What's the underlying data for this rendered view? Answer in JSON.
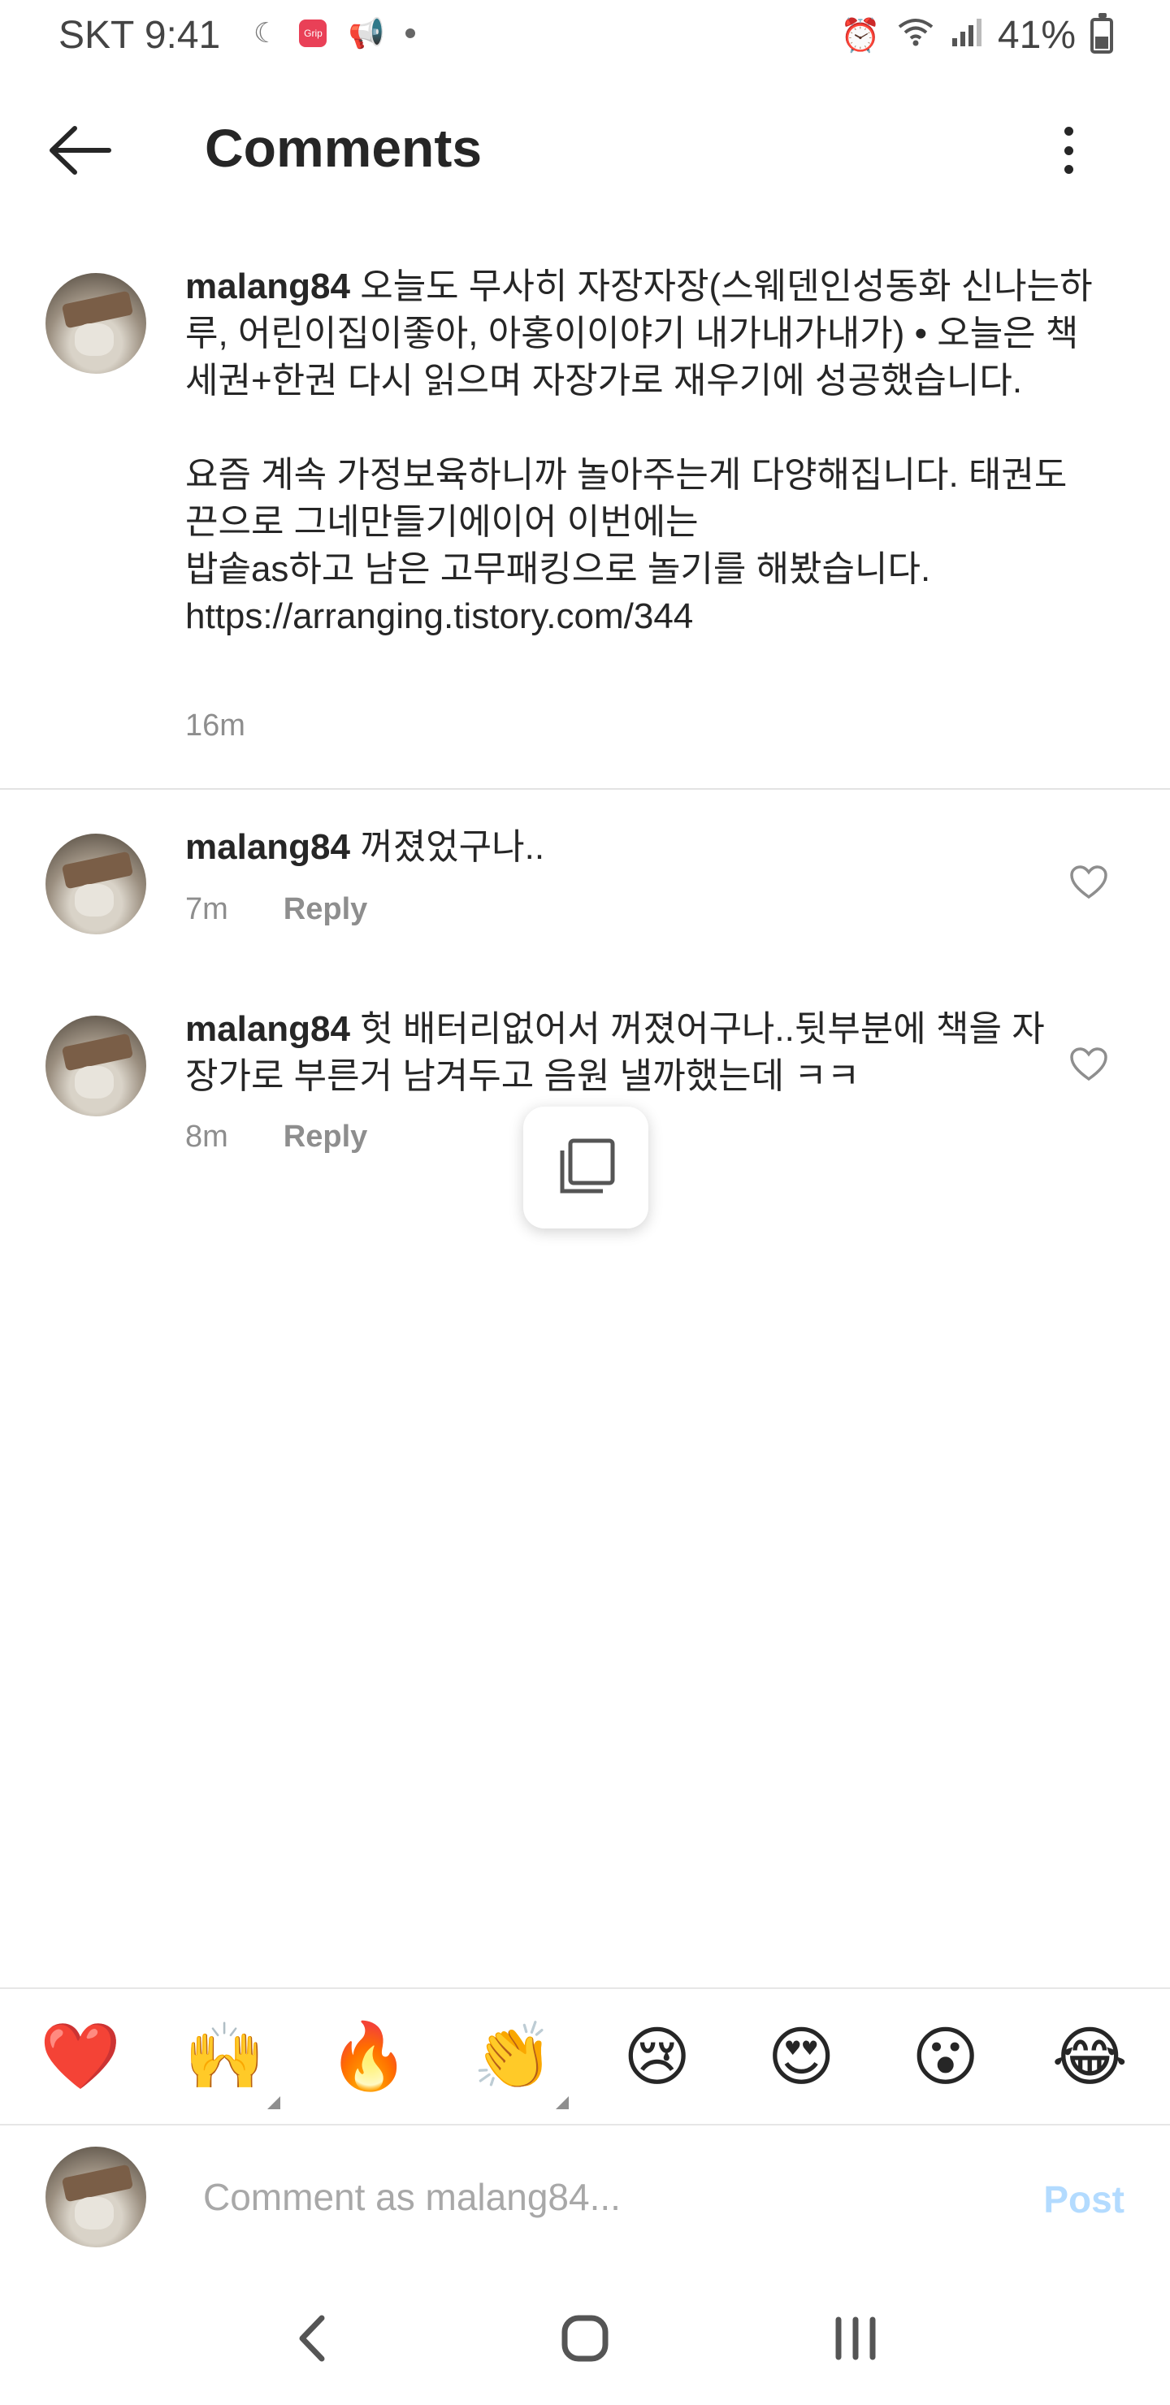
{
  "status_bar": {
    "carrier_time": "SKT 9:41",
    "app_badge": "Grip",
    "battery": "41%"
  },
  "header": {
    "title": "Comments"
  },
  "caption": {
    "username": "malang84",
    "text": " 오늘도 무사히 자장자장(스웨덴인성동화 신나는하루, 어린이집이좋아, 아홍이이야기 내가내가내가) • 오늘은 책세권+한권 다시 읽으며 자장가로 재우기에 성공했습니다.\n\n요즘 계속 가정보육하니까 놀아주는게 다양해집니다. 태권도 끈으로 그네만들기에이어 이번에는\n밥솥as하고 남은 고무패킹으로 놀기를 해봤습니다.\nhttps://arranging.tistory.com/344",
    "time": "16m"
  },
  "comments": [
    {
      "username": "malang84",
      "text": " 꺼졌었구나..",
      "time": "7m",
      "reply_label": "Reply"
    },
    {
      "username": "malang84",
      "text": " 헛 배터리없어서 꺼졌어구나..뒷부분에 책을 자장가로 부른거 남겨두고 음원 낼까했는데 ㅋㅋ",
      "time": "8m",
      "reply_label": "Reply"
    }
  ],
  "emoji_bar": [
    "❤️",
    "🙌",
    "🔥",
    "👏",
    "😢",
    "😍",
    "😮",
    "😂"
  ],
  "composer": {
    "placeholder": "Comment as malang84...",
    "post_label": "Post"
  },
  "colors": {
    "accent_disabled": "#b3dbff",
    "secondary_text": "#8e8e8e",
    "primary_text": "#262626"
  }
}
